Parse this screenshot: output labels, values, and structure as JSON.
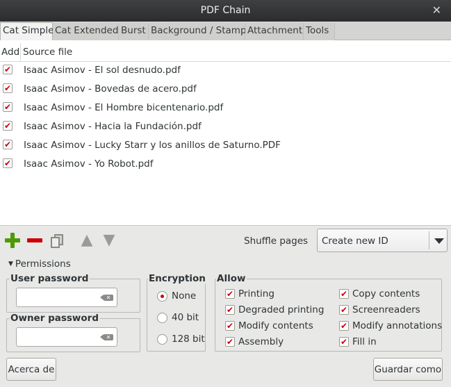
{
  "window": {
    "title": "PDF Chain",
    "close_glyph": "✕"
  },
  "tabs": [
    {
      "label": "Cat Simple",
      "active": true
    },
    {
      "label": "Cat Extended"
    },
    {
      "label": "Burst"
    },
    {
      "label": "Background / Stamp"
    },
    {
      "label": "Attachment"
    },
    {
      "label": "Tools"
    }
  ],
  "file_list": {
    "columns": {
      "add": "Add",
      "source": "Source file"
    },
    "rows": [
      {
        "checked": true,
        "file": "Isaac Asimov - El sol desnudo.pdf"
      },
      {
        "checked": true,
        "file": "Isaac Asimov - Bovedas de acero.pdf"
      },
      {
        "checked": true,
        "file": "Isaac Asimov - El Hombre bicentenario.pdf"
      },
      {
        "checked": true,
        "file": "Isaac Asimov - Hacia la Fundación.pdf"
      },
      {
        "checked": true,
        "file": "Isaac Asimov - Lucky Starr y los anillos de Saturno.PDF"
      },
      {
        "checked": true,
        "file": "Isaac Asimov - Yo Robot.pdf"
      }
    ],
    "check_glyph": "✔"
  },
  "toolbar": {
    "icons": [
      "plus-icon",
      "minus-icon",
      "copy-icon",
      "arrow-up-icon",
      "arrow-down-icon"
    ],
    "up_glyph": "▲",
    "down_glyph": "▼",
    "shuffle_label": "Shuffle pages",
    "id_select_value": "Create new ID"
  },
  "permissions": {
    "toggle_label": "Permissions",
    "toggle_glyph": "▼",
    "user_password": {
      "label": "User password",
      "value": ""
    },
    "owner_password": {
      "label": "Owner password",
      "value": ""
    },
    "clear_glyph": "✕",
    "encryption": {
      "label": "Encryption",
      "options": [
        {
          "label": "None",
          "selected": true
        },
        {
          "label": "40 bit",
          "selected": false
        },
        {
          "label": "128 bit",
          "selected": false
        }
      ]
    },
    "allow": {
      "label": "Allow",
      "items": [
        {
          "label": "Printing",
          "checked": true
        },
        {
          "label": "Copy contents",
          "checked": true
        },
        {
          "label": "Degraded printing",
          "checked": true
        },
        {
          "label": "Screenreaders",
          "checked": true
        },
        {
          "label": "Modify contents",
          "checked": true
        },
        {
          "label": "Modify annotations",
          "checked": true
        },
        {
          "label": "Assembly",
          "checked": true
        },
        {
          "label": "Fill in",
          "checked": true
        }
      ]
    }
  },
  "footer": {
    "about_label": "Acerca de",
    "save_label": "Guardar como"
  },
  "colors": {
    "accent": "#cc0000",
    "add": "#4e9a06",
    "titlebar": "#2b2c2e"
  }
}
